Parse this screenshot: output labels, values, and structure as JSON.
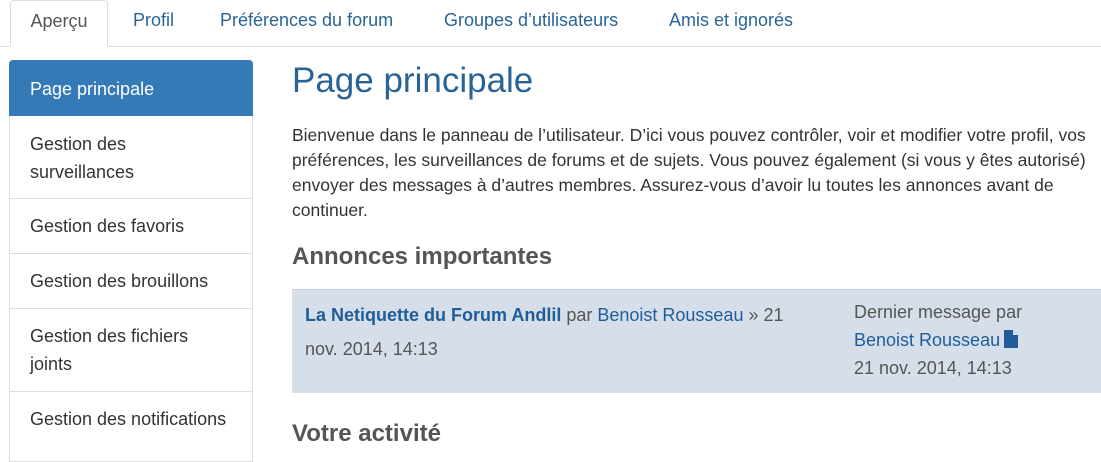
{
  "tabs": [
    {
      "label": "Aperçu",
      "active": true
    },
    {
      "label": "Profil"
    },
    {
      "label": "Préférences du forum"
    },
    {
      "label": "Groupes d’utilisateurs"
    },
    {
      "label": "Amis et ignorés"
    }
  ],
  "sidebar": {
    "items": [
      {
        "label": "Page principale",
        "active": true
      },
      {
        "label": "Gestion des surveillances"
      },
      {
        "label": "Gestion des favoris"
      },
      {
        "label": "Gestion des brouillons"
      },
      {
        "label": "Gestion des fichiers joints"
      },
      {
        "label": "Gestion des notifications"
      }
    ]
  },
  "main": {
    "title": "Page principale",
    "intro": "Bienvenue dans le panneau de l’utilisateur. D’ici vous pouvez contrôler, voir et modifier votre profil, vos préférences, les surveillances de forums et de sujets. Vous pouvez également (si vous y êtes autorisé) envoyer des messages à d’autres membres. Assurez-vous d’avoir lu toutes les annonces avant de continuer.",
    "announcements_title": "Annonces importantes",
    "announcement": {
      "topic_title": "La Netiquette du Forum Andlil",
      "by_text": "par",
      "author": "Benoist Rousseau",
      "date_prefix": "»",
      "date": "21 nov. 2014, 14:13",
      "last_post_label": "Dernier message par",
      "last_post_author": "Benoist Rousseau",
      "last_post_icon": "document-icon",
      "last_post_date": "21 nov. 2014, 14:13"
    },
    "activity_title": "Votre activité"
  },
  "colors": {
    "link": "#1f5c99",
    "active_tab_bg": "#337ab7",
    "announcement_bg": "#d6dfe9"
  }
}
